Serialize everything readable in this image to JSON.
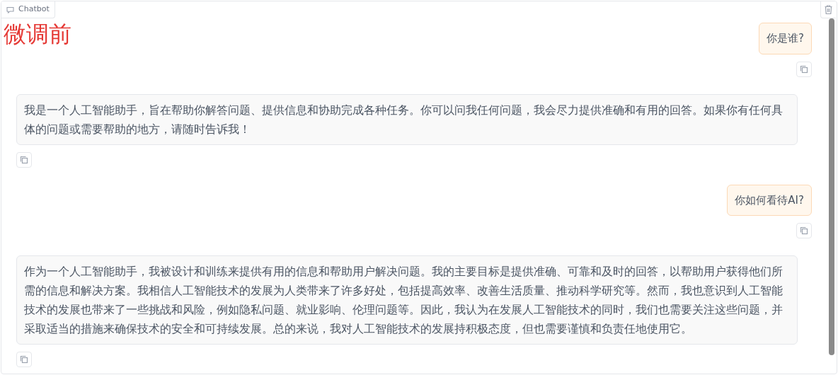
{
  "panel": {
    "label": "Chatbot"
  },
  "heading": "微调前",
  "messages": [
    {
      "kind": "user",
      "text": "你是谁?"
    },
    {
      "kind": "bot",
      "text": "我是一个人工智能助手，旨在帮助你解答问题、提供信息和协助完成各种任务。你可以问我任何问题，我会尽力提供准确和有用的回答。如果你有任何具体的问题或需要帮助的地方，请随时告诉我！"
    },
    {
      "kind": "user",
      "text": "你如何看待AI?"
    },
    {
      "kind": "bot",
      "text": "作为一个人工智能助手，我被设计和训练来提供有用的信息和帮助用户解决问题。我的主要目标是提供准确、可靠和及时的回答，以帮助用户获得他们所需的信息和解决方案。我相信人工智能技术的发展为人类带来了许多好处，包括提高效率、改善生活质量、推动科学研究等。然而，我也意识到人工智能技术的发展也带来了一些挑战和风险，例如隐私问题、就业影响、伦理问题等。因此，我认为在发展人工智能技术的同时，我们也需要关注这些问题，并采取适当的措施来确保技术的安全和可持续发展。总的来说，我对人工智能技术的发展持积极态度，但也需要谨慎和负责任地使用它。"
    }
  ]
}
